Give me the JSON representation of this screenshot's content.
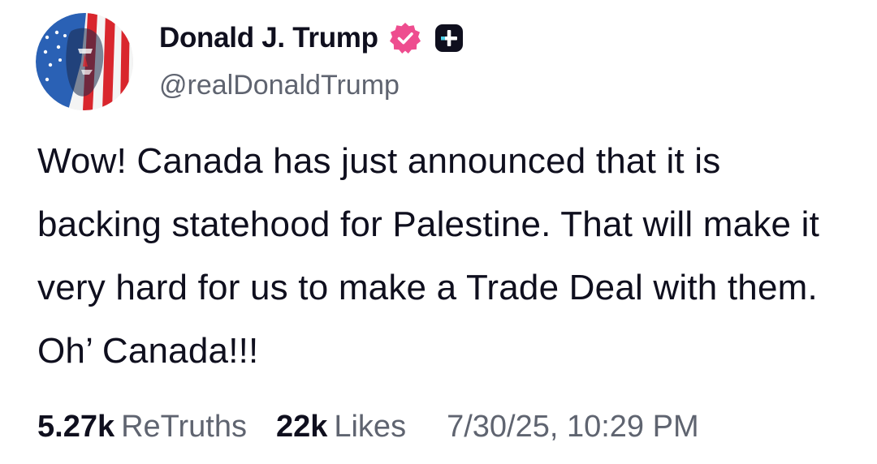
{
  "author": {
    "display_name": "Donald J. Trump",
    "handle": "@realDonaldTrump",
    "verified_icon": "verified-badge-icon",
    "badge_icon": "plus-badge-icon",
    "verified_color": "#ee4d8f",
    "badge_color": "#0f0f1e"
  },
  "post": {
    "text": "Wow! Canada has just announced that it is backing statehood for Palestine. That will make it very hard for us to make a Trade Deal with them. Oh’ Canada!!!"
  },
  "stats": {
    "retruths_count": "5.27k",
    "retruths_label": "ReTruths",
    "likes_count": "22k",
    "likes_label": "Likes",
    "timestamp": "7/30/25, 10:29 PM"
  },
  "colors": {
    "text_primary": "#0f0f1e",
    "text_secondary": "#5f6470",
    "flag_red": "#d9262d",
    "flag_blue": "#2a61b5"
  }
}
